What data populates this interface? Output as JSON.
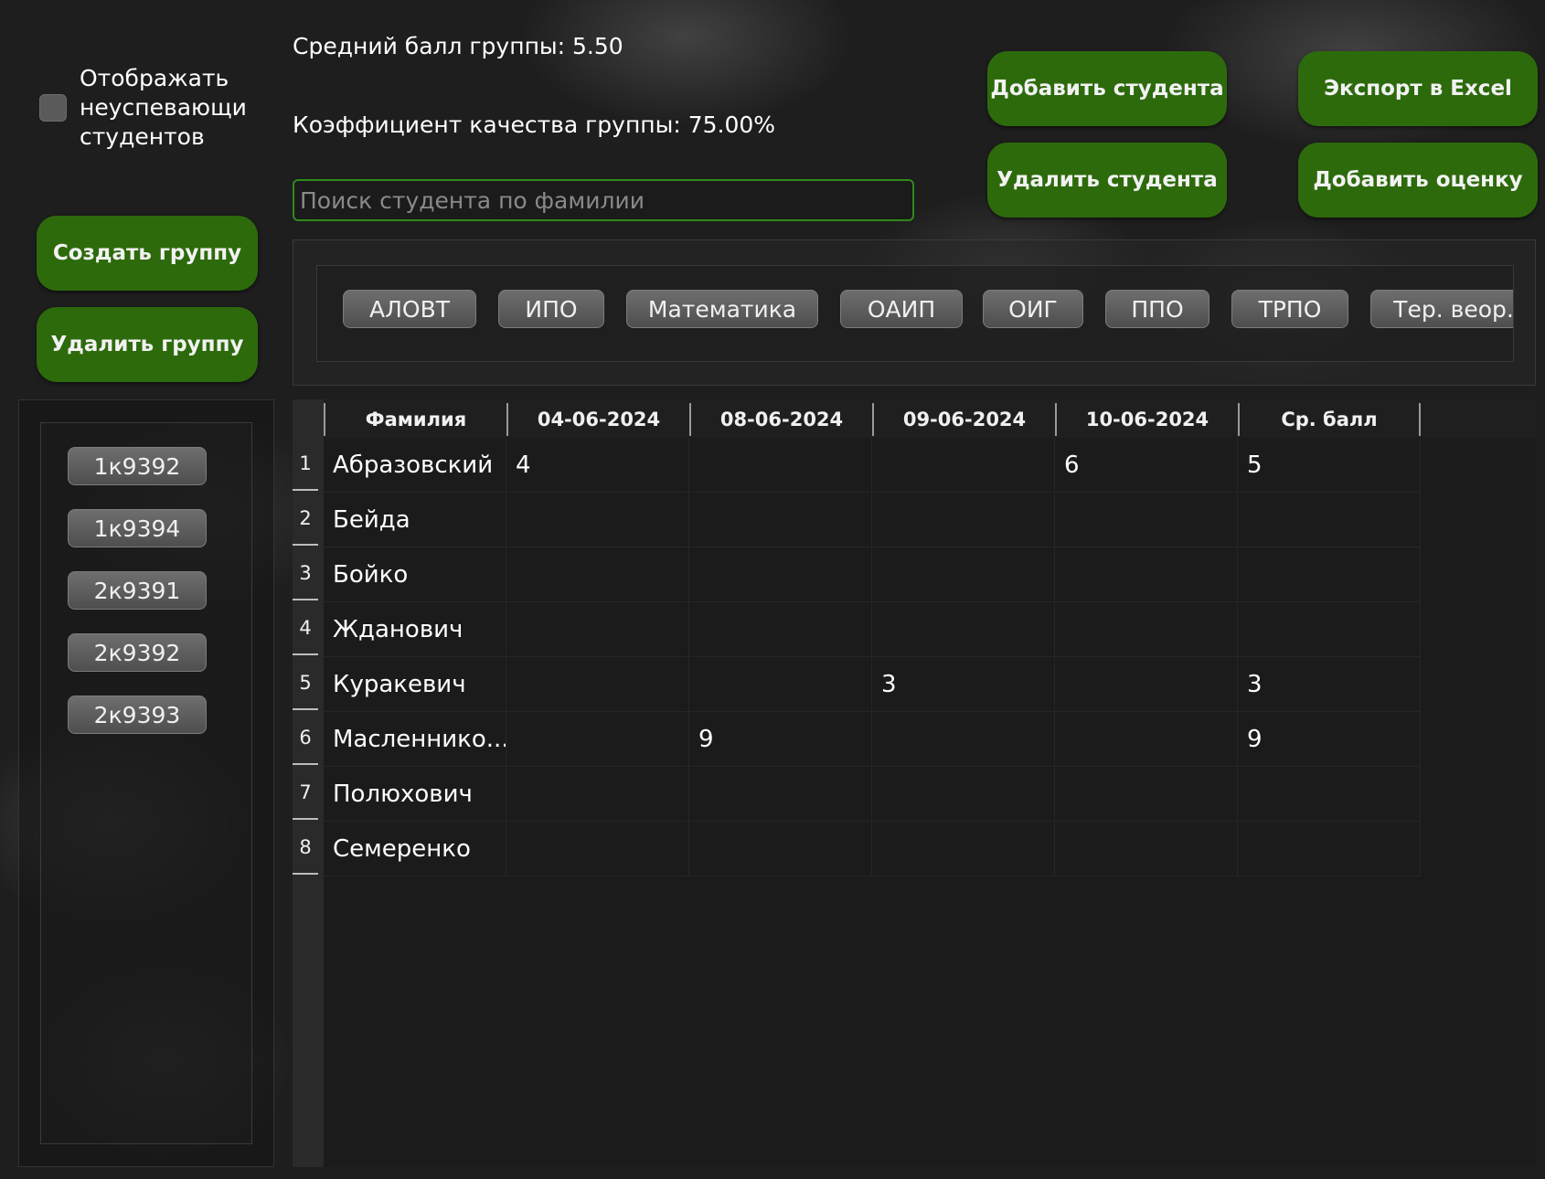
{
  "sidebar": {
    "show_failing_label": "Отображать\nнеуспевающи\nстудентов",
    "create_group_label": "Создать группу",
    "delete_group_label": "Удалить группу",
    "groups": [
      "1к9392",
      "1к9394",
      "2к9391",
      "2к9392",
      "2к9393"
    ]
  },
  "stats": {
    "avg_score": "Средний балл группы: 5.50",
    "quality_coef": "Коэффициент качества группы: 75.00%"
  },
  "search": {
    "placeholder": "Поиск студента по фамилии"
  },
  "actions": {
    "add_student": "Добавить студента",
    "delete_student": "Удалить студента",
    "export_excel": "Экспорт в Excel",
    "add_grade": "Добавить оценку"
  },
  "subjects": [
    "АЛОВТ",
    "ИПО",
    "Математика",
    "ОАИП",
    "ОИГ",
    "ППО",
    "ТРПО",
    "Тер. веор."
  ],
  "table": {
    "headers": [
      "Фамилия",
      "04-06-2024",
      "08-06-2024",
      "09-06-2024",
      "10-06-2024",
      "Ср. балл"
    ],
    "rows": [
      {
        "num": "1",
        "cells": [
          "Абразовский",
          "4",
          "",
          "",
          "6",
          "5"
        ]
      },
      {
        "num": "2",
        "cells": [
          "Бейда",
          "",
          "",
          "",
          "",
          ""
        ]
      },
      {
        "num": "3",
        "cells": [
          "Бойко",
          "",
          "",
          "",
          "",
          ""
        ]
      },
      {
        "num": "4",
        "cells": [
          "Жданович",
          "",
          "",
          "",
          "",
          ""
        ]
      },
      {
        "num": "5",
        "cells": [
          "Куракевич",
          "",
          "",
          "3",
          "",
          "3"
        ]
      },
      {
        "num": "6",
        "cells": [
          "Масленнико...",
          "",
          "9",
          "",
          "",
          "9"
        ]
      },
      {
        "num": "7",
        "cells": [
          "Полюхович",
          "",
          "",
          "",
          "",
          ""
        ]
      },
      {
        "num": "8",
        "cells": [
          "Семеренко",
          "",
          "",
          "",
          "",
          ""
        ]
      }
    ]
  },
  "colors": {
    "accent_green": "#2d6a0c",
    "search_border": "#2f8a1a",
    "background": "#1e1e1e"
  }
}
